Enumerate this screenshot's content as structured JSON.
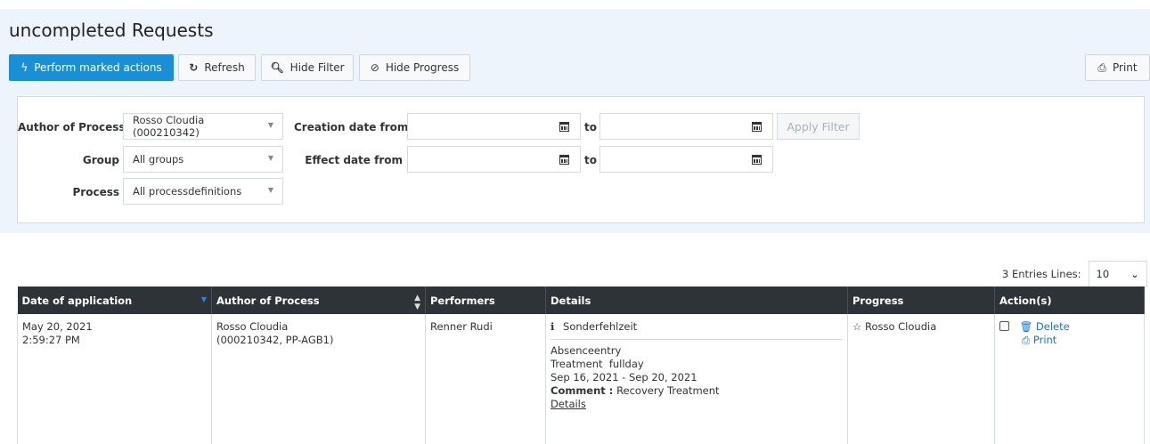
{
  "page": {
    "title": "uncompleted Requests"
  },
  "toolbar": {
    "perform_label": "Perform marked actions",
    "refresh_label": "Refresh",
    "hide_filter_label": "Hide Filter",
    "hide_progress_label": "Hide Progress",
    "print_label": "Print"
  },
  "filter": {
    "author_label": "Author of Process",
    "author_value": "Rosso Cloudia (000210342)",
    "group_label": "Group",
    "group_value": "All groups",
    "process_label": "Process",
    "process_value": "All processdefinitions",
    "creation_from_label": "Creation date from",
    "effect_from_label": "Effect date from",
    "to_label": "to",
    "apply_label": "Apply Filter"
  },
  "pagination": {
    "entries_text": "3 Entries Lines:",
    "lines_value": "10"
  },
  "table": {
    "headers": [
      "Date of application",
      "Author of Process",
      "Performers",
      "Details",
      "Progress",
      "Action(s)"
    ],
    "rows": [
      {
        "date": "May 20, 2021",
        "time": "2:59:27 PM",
        "author_name": "Rosso Cloudia",
        "author_id": "(000210342, PP-AGB1)",
        "performer": "Renner Rudi",
        "details_title": "Sonderfehlzeit",
        "details_type": "Absenceentry",
        "details_treatment": "Treatment  fullday",
        "details_range": "Sep 16, 2021 - Sep 20, 2021",
        "comment_label": "Comment :",
        "comment_value": "Recovery Treatment",
        "details_link": "Details",
        "progress": "Rosso Cloudia",
        "action_delete": "Delete",
        "action_print": "Print"
      }
    ]
  },
  "colors": {
    "primary": "#1a8fd6",
    "header_bg": "#2e3338",
    "panel_bg": "#eef4fb",
    "link": "#1a73c9"
  }
}
